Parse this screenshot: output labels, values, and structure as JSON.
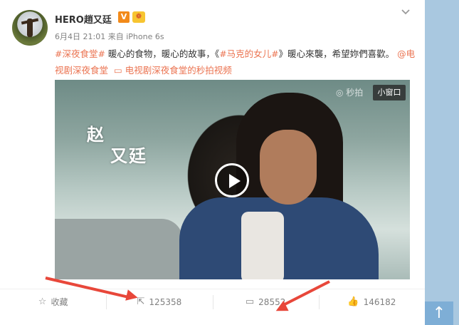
{
  "post": {
    "username": "HERO趙又廷",
    "badge_v": "V",
    "badge_vip": "❁",
    "time": "6月4日 21:01",
    "source_prefix": "来自",
    "source": "iPhone 6s",
    "text": {
      "tag1": "#深夜食堂#",
      "part1": " 暖心的食物，暖心的故事，《",
      "tag2": "#马克的女儿#",
      "part2": "》暖心來襲，希望妳們喜歡。",
      "mention": "@电视剧深夜食堂",
      "video_link": "电视剧深夜食堂的秒拍视频"
    },
    "video": {
      "title_line1": "赵",
      "title_line2": "又廷",
      "watermark": "◎ 秒拍",
      "mini_window": "小窗口"
    }
  },
  "actions": {
    "favorite": "收藏",
    "repost": "125358",
    "comment": "28552",
    "like": "146182"
  },
  "icons": {
    "favorite": "star-icon",
    "repost": "share-icon",
    "comment": "comment-icon",
    "like": "thumbs-up-icon",
    "more": "chevron-down-icon",
    "back_to_top": "arrow-up-icon"
  },
  "colors": {
    "tag": "#eb7350",
    "annotation_arrow": "#e8473a"
  }
}
